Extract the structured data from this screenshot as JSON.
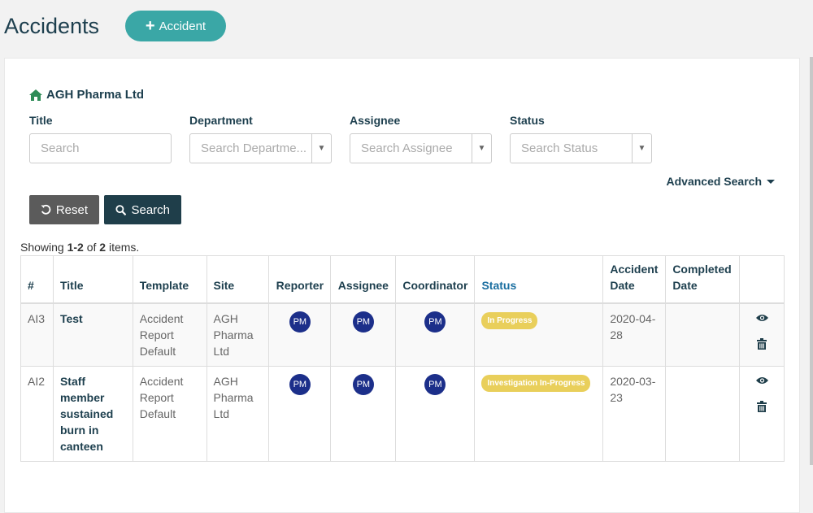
{
  "page": {
    "title": "Accidents",
    "add_button": "Accident"
  },
  "company": {
    "name": "AGH Pharma Ltd"
  },
  "filters": {
    "title": {
      "label": "Title",
      "placeholder": "Search"
    },
    "department": {
      "label": "Department",
      "placeholder": "Search Departme..."
    },
    "assignee": {
      "label": "Assignee",
      "placeholder": "Search Assignee"
    },
    "status": {
      "label": "Status",
      "placeholder": "Search Status"
    },
    "advanced": "Advanced Search"
  },
  "buttons": {
    "reset": "Reset",
    "search": "Search"
  },
  "summary": {
    "prefix": "Showing ",
    "range": "1-2",
    "of": " of ",
    "total": "2",
    "suffix": " items."
  },
  "table": {
    "headers": {
      "num": "#",
      "title": "Title",
      "template": "Template",
      "site": "Site",
      "reporter": "Reporter",
      "assignee": "Assignee",
      "coordinator": "Coordinator",
      "status": "Status",
      "accident_date": "Accident Date",
      "completed_date": "Completed Date"
    },
    "rows": [
      {
        "id": "AI3",
        "title": "Test",
        "template": "Accident Report Default",
        "site": "AGH Pharma Ltd",
        "reporter": "PM",
        "assignee": "PM",
        "coordinator": "PM",
        "status": "In Progress",
        "accident_date": "2020-04-28",
        "completed_date": ""
      },
      {
        "id": "AI2",
        "title": "Staff member sustained burn in canteen",
        "template": "Accident Report Default",
        "site": "AGH Pharma Ltd",
        "reporter": "PM",
        "assignee": "PM",
        "coordinator": "PM",
        "status": "Investigation In-Progress",
        "accident_date": "2020-03-23",
        "completed_date": ""
      }
    ]
  },
  "colors": {
    "accent": "#3aa7a6",
    "dark": "#1f3e4a",
    "avatar": "#1c2f8a",
    "badge": "#e9cf5b"
  }
}
